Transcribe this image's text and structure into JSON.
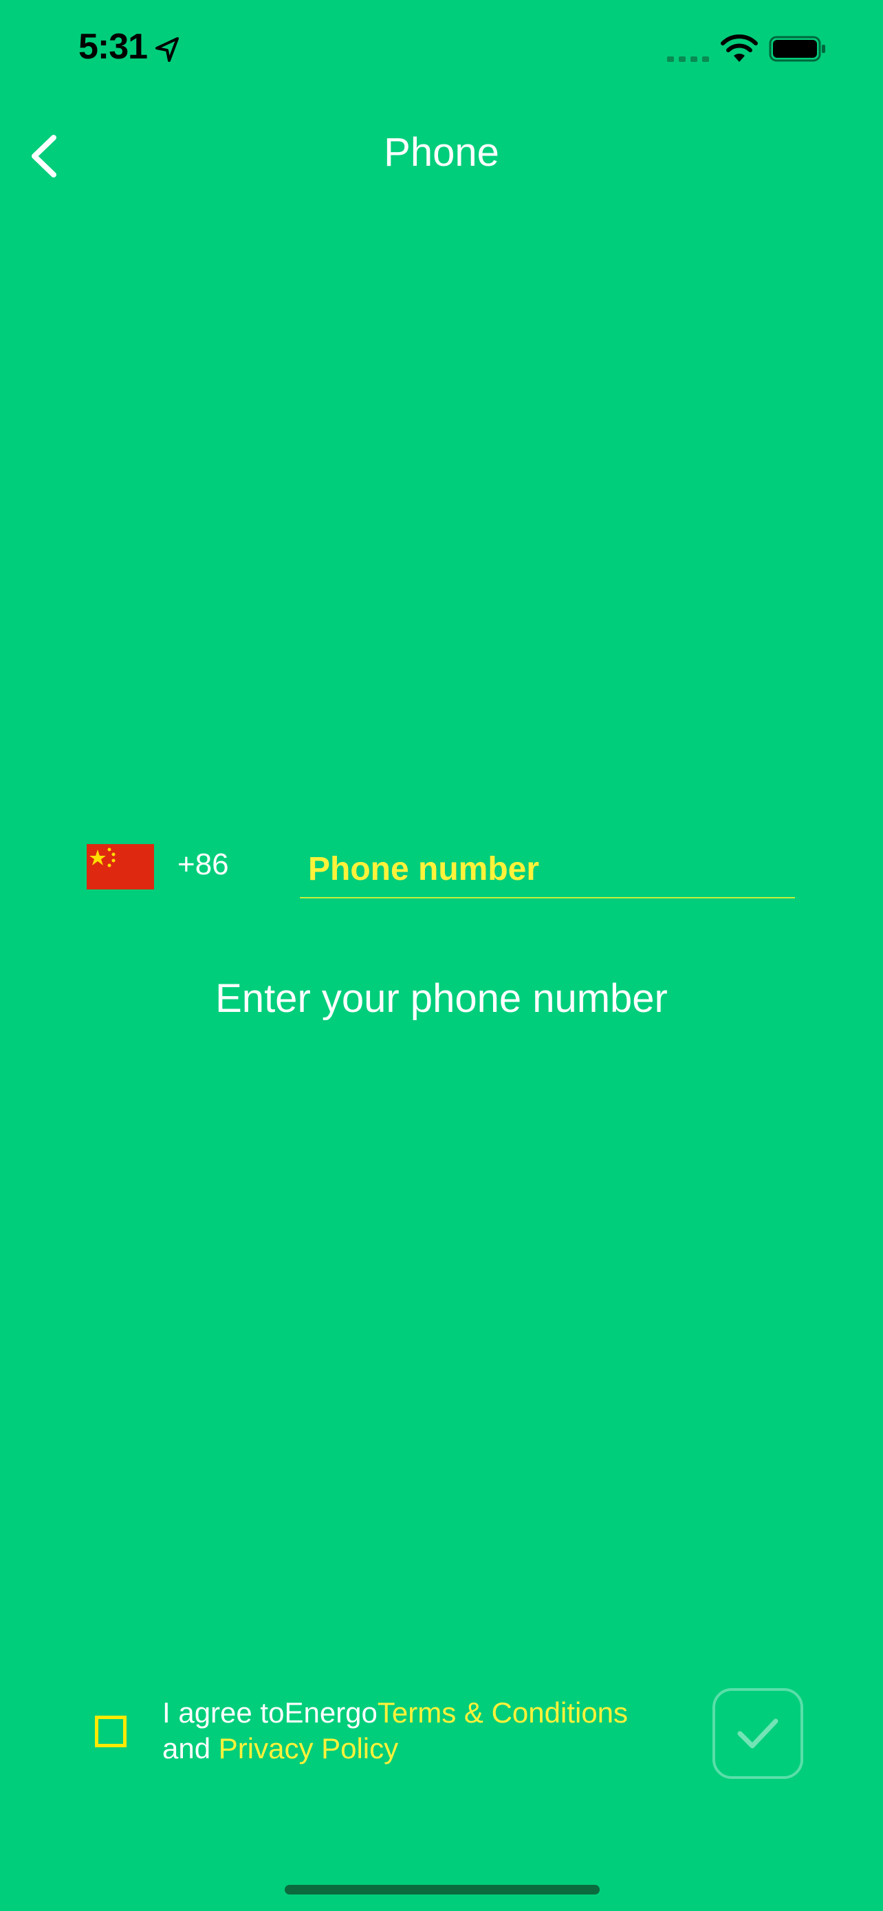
{
  "status_bar": {
    "time": "5:31",
    "icons": [
      "location-arrow-icon",
      "cellular-signal-icon",
      "wifi-icon",
      "battery-icon"
    ]
  },
  "nav": {
    "title": "Phone",
    "back_icon": "chevron-left-icon"
  },
  "phone_form": {
    "country_flag": "china-flag-icon",
    "country_code": "+86",
    "placeholder": "Phone number",
    "value": "",
    "hint": "Enter your phone number"
  },
  "agreement": {
    "prefix": "I agree to",
    "brand": "Energo",
    "terms_link": "Terms & Conditions",
    "and_text": "and",
    "privacy_link": "Privacy Policy",
    "checked": false
  },
  "confirm_button": {
    "icon": "checkmark-icon"
  },
  "colors": {
    "background": "#00CE7B",
    "accent_yellow": "#FFF23A",
    "text": "#FFFFFF"
  }
}
